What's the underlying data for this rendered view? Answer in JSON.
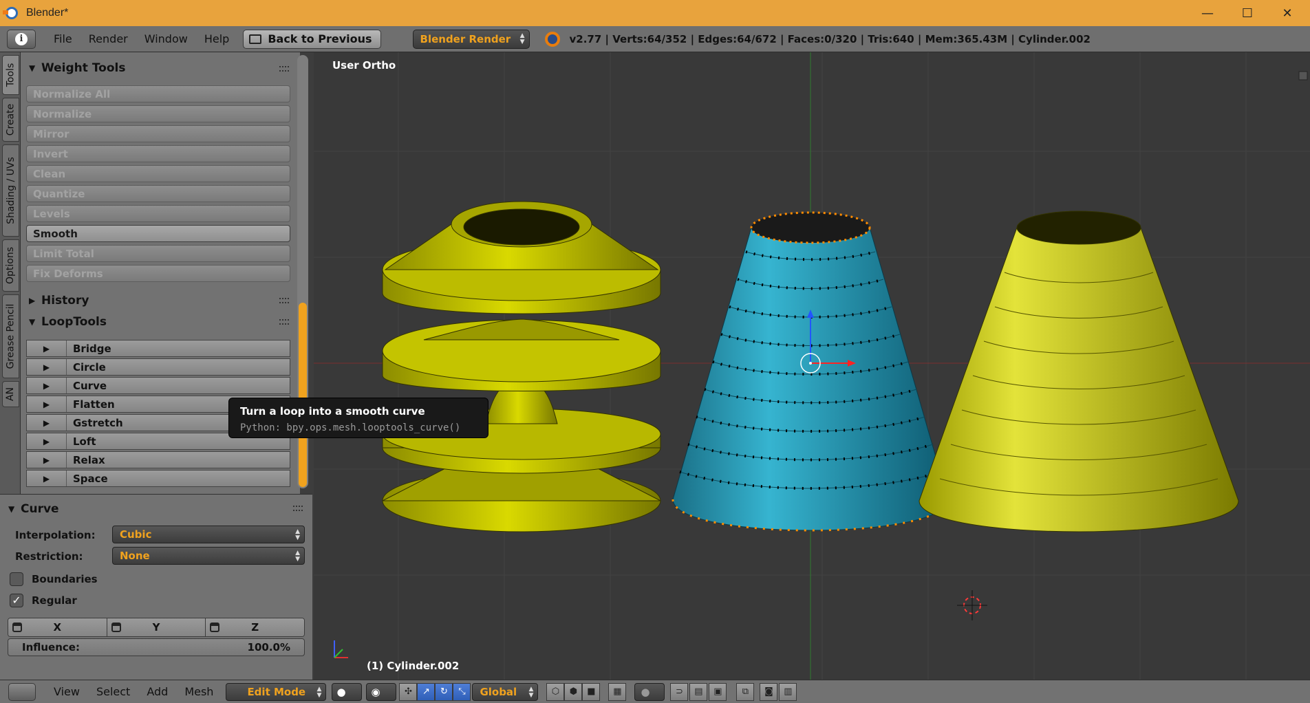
{
  "window": {
    "title": "Blender*",
    "minimize": "—",
    "maximize": "☐",
    "close": "✕"
  },
  "infobar": {
    "menus": [
      "File",
      "Render",
      "Window",
      "Help"
    ],
    "back_button": "Back to Previous",
    "render_engine": "Blender Render",
    "stats": "v2.77 | Verts:64/352 | Edges:64/672 | Faces:0/320 | Tris:640 | Mem:365.43M | Cylinder.002"
  },
  "side_tabs": [
    "Tools",
    "Create",
    "Shading / UVs",
    "Options",
    "Grease Pencil",
    "AN"
  ],
  "weight_tools": {
    "title": "Weight Tools",
    "buttons": [
      {
        "label": "Normalize All",
        "enabled": false
      },
      {
        "label": "Normalize",
        "enabled": false
      },
      {
        "label": "Mirror",
        "enabled": false
      },
      {
        "label": "Invert",
        "enabled": false
      },
      {
        "label": "Clean",
        "enabled": false
      },
      {
        "label": "Quantize",
        "enabled": false
      },
      {
        "label": "Levels",
        "enabled": false
      },
      {
        "label": "Smooth",
        "enabled": true
      },
      {
        "label": "Limit Total",
        "enabled": false
      },
      {
        "label": "Fix Deforms",
        "enabled": false
      }
    ]
  },
  "history": {
    "title": "History"
  },
  "looptools": {
    "title": "LoopTools",
    "items": [
      "Bridge",
      "Circle",
      "Curve",
      "Flatten",
      "Gstretch",
      "Loft",
      "Relax",
      "Space"
    ]
  },
  "tooltip": {
    "title": "Turn a loop into a smooth curve",
    "python": "Python: bpy.ops.mesh.looptools_curve()"
  },
  "operator": {
    "title": "Curve",
    "interpolation_label": "Interpolation:",
    "interpolation_value": "Cubic",
    "restriction_label": "Restriction:",
    "restriction_value": "None",
    "boundaries_label": "Boundaries",
    "boundaries_checked": false,
    "regular_label": "Regular",
    "regular_checked": true,
    "axes": [
      "X",
      "Y",
      "Z"
    ],
    "influence_label": "Influence:",
    "influence_value": "100.0%"
  },
  "viewport": {
    "view_name": "User Ortho",
    "object_label": "(1) Cylinder.002",
    "colors": {
      "background": "#393939",
      "mesh_yellow": "#c7c700",
      "mesh_selected": "#1f8fa8",
      "select_orange": "#ff8c00"
    }
  },
  "bottombar": {
    "menus": [
      "View",
      "Select",
      "Add",
      "Mesh"
    ],
    "mode": "Edit Mode",
    "orientation": "Global"
  }
}
